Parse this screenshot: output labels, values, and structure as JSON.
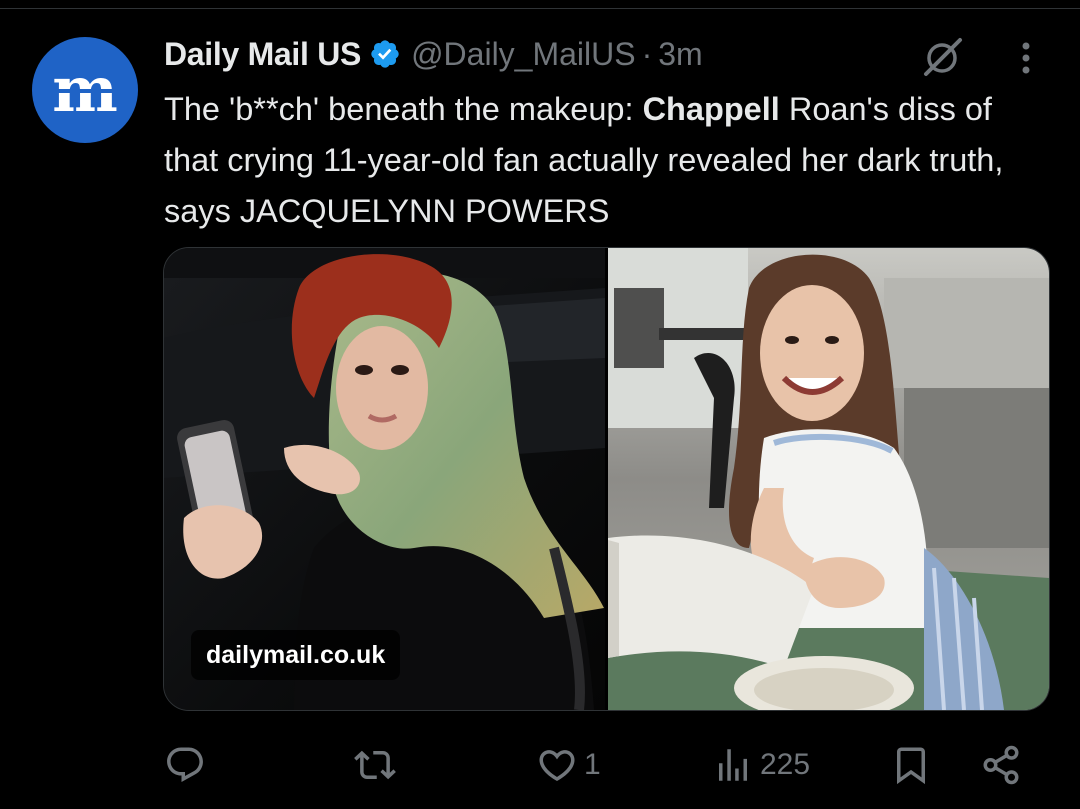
{
  "account": {
    "display_name": "Daily Mail US",
    "handle": "@Daily_MailUS",
    "separator": "·",
    "timestamp": "3m",
    "avatar_icon": "daily-mail-logo",
    "verified_icon": "verified-badge-icon"
  },
  "tweet": {
    "text_part1": "The 'b**ch' beneath the makeup: ",
    "text_bold": "Chappell",
    "text_part2": " Roan's diss of that crying 11-year-old fan actually revealed her dark truth, says JACQUELYNN POWERS"
  },
  "media": {
    "source": "dailymail.co.uk"
  },
  "actions": {
    "reply_icon": "reply-icon",
    "retweet_icon": "retweet-icon",
    "like_icon": "heart-icon",
    "like_count": "1",
    "views_icon": "views-icon",
    "views_count": "225",
    "bookmark_icon": "bookmark-icon",
    "share_icon": "share-icon"
  },
  "colors": {
    "background": "#000000",
    "text": "#e7e9ea",
    "muted": "#71767b",
    "verified": "#1d9bf0",
    "avatar": "#1f63c6"
  }
}
